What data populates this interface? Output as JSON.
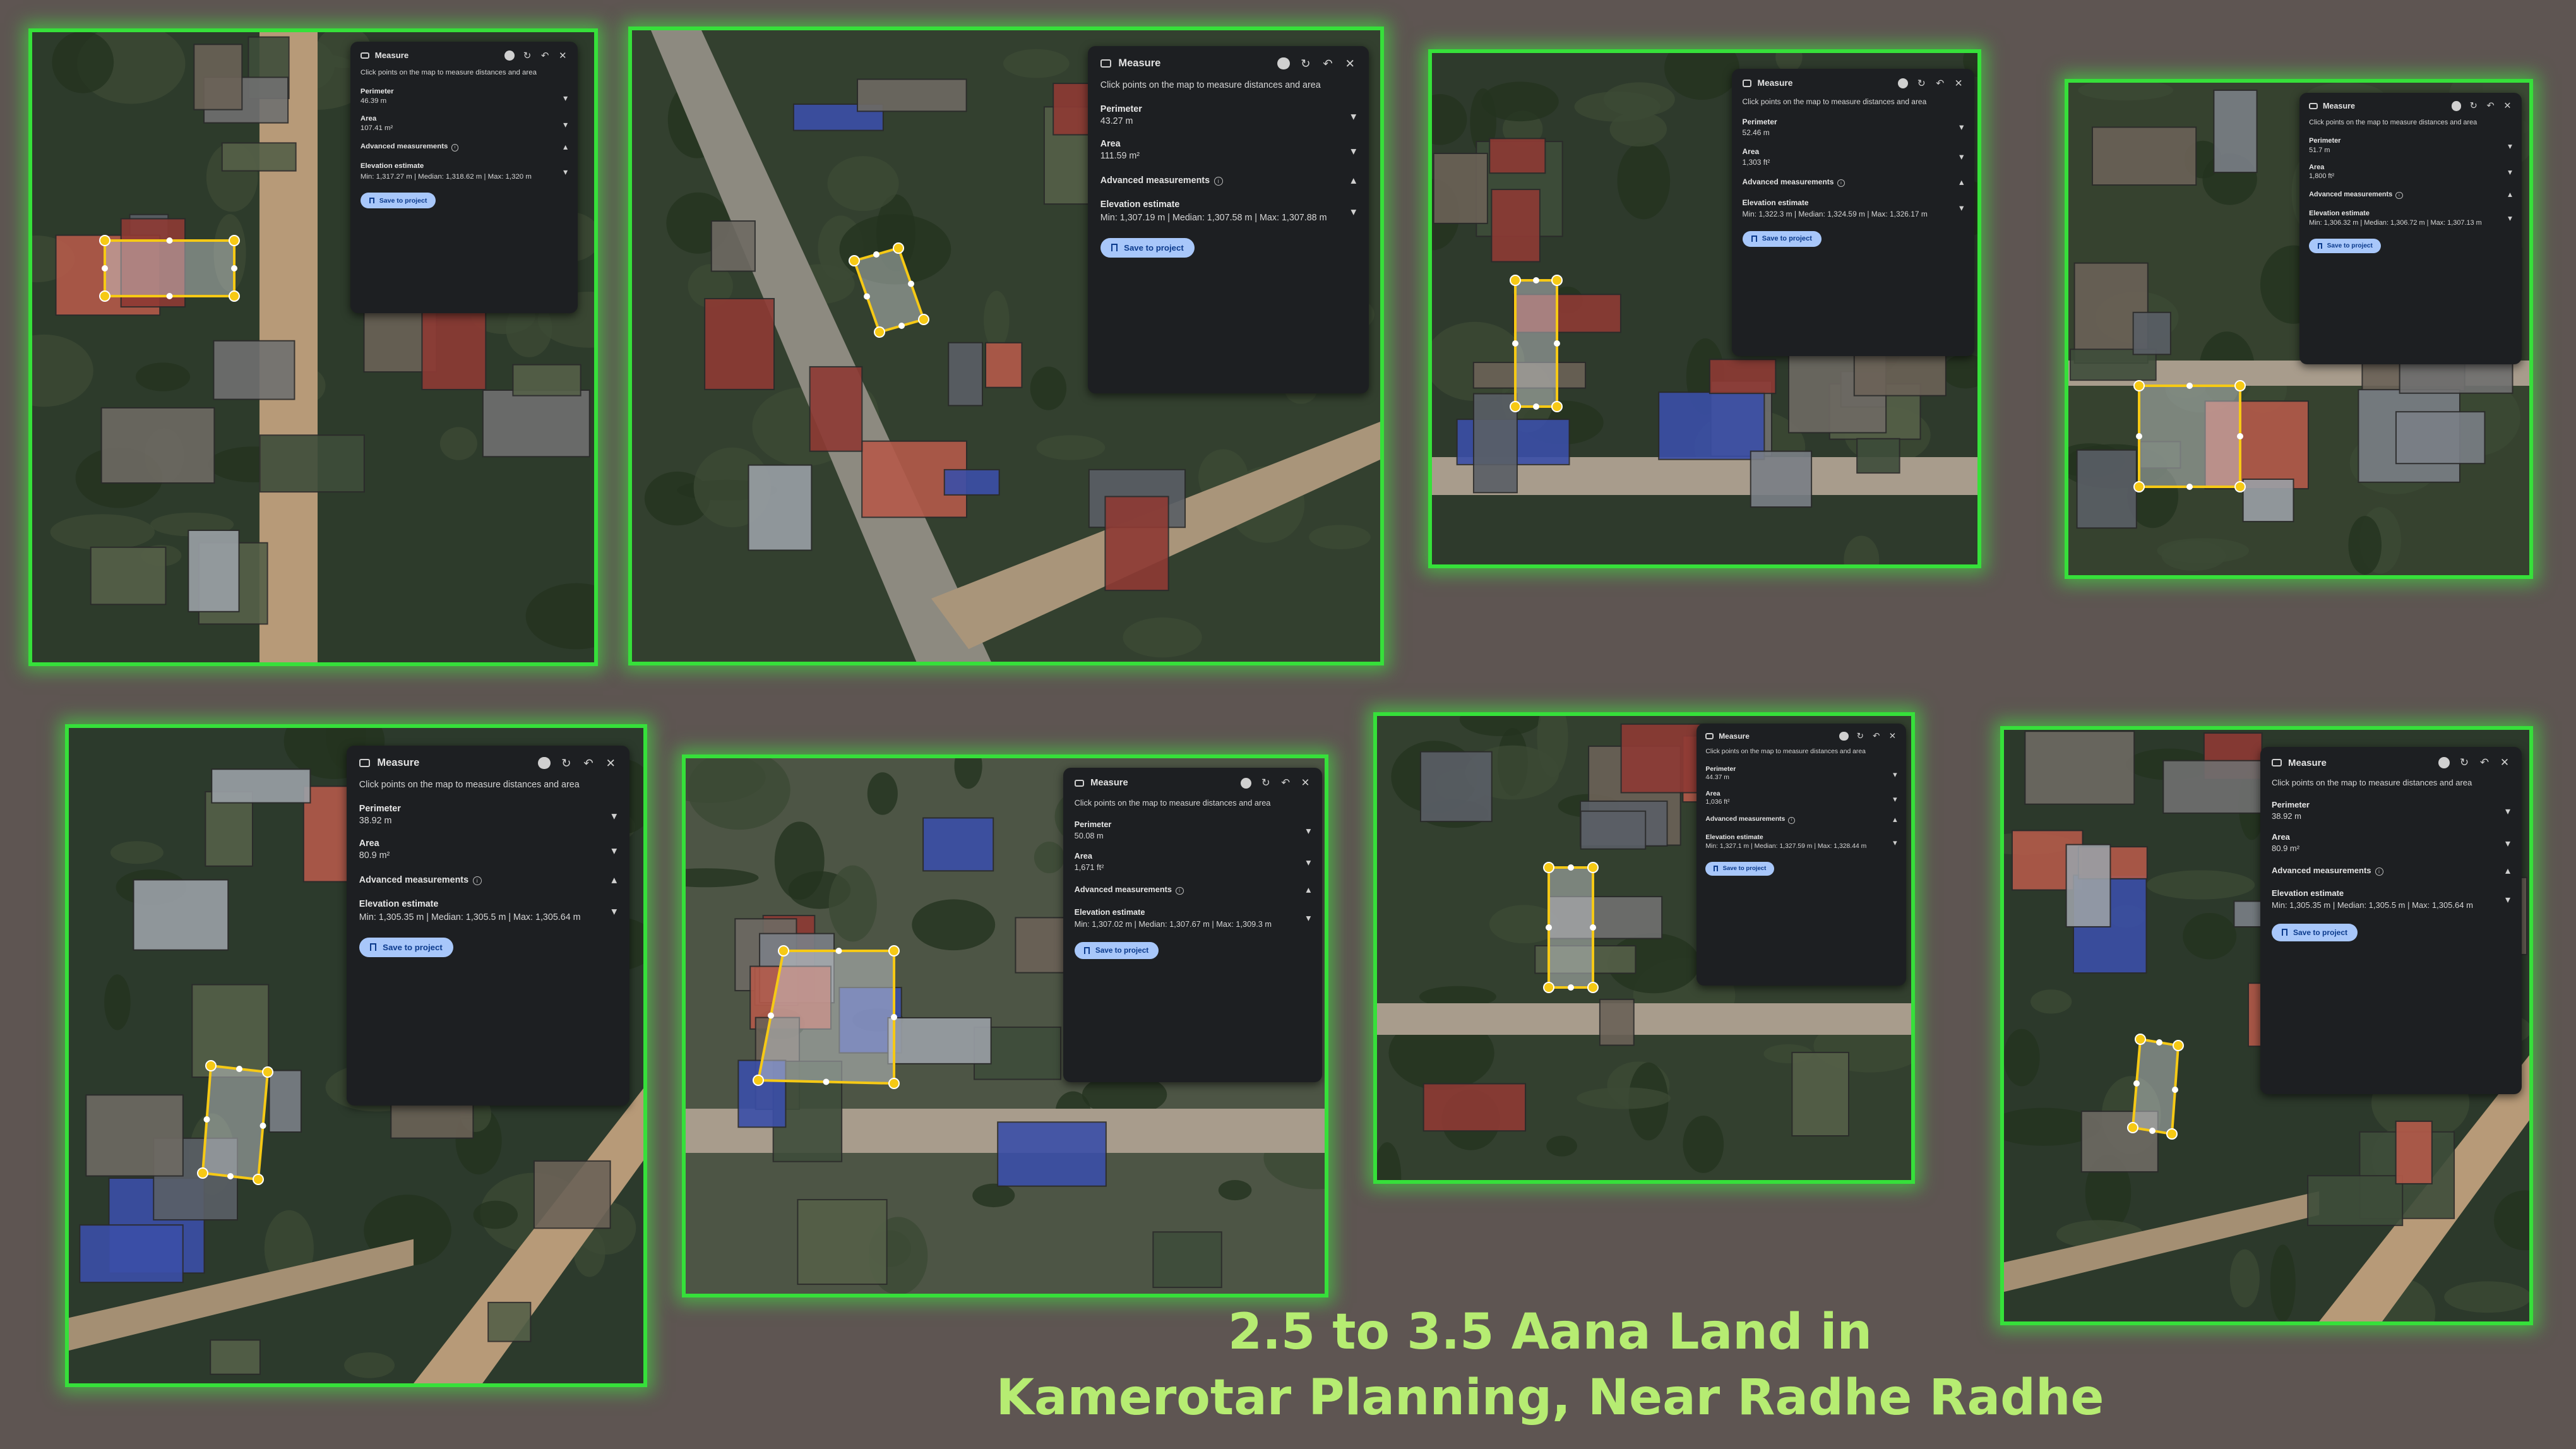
{
  "caption": {
    "line1": "2.5 to 3.5 Aana Land in",
    "line2": "Kamerotar Planning, Near Radhe Radhe"
  },
  "colors": {
    "frame_glow": "#36e03a",
    "background": "#5e5552",
    "caption_text": "#b6ec72",
    "polygon_outline": "#f6c915",
    "panel_bg": "#1d1f22",
    "save_button": "#a8c7fa"
  },
  "panel_common": {
    "title": "Measure",
    "instructions": "Click points on the map to measure distances and area",
    "perimeter_label": "Perimeter",
    "area_label": "Area",
    "advanced_label": "Advanced measurements",
    "elevation_label": "Elevation estimate",
    "save_label": "Save to project",
    "icons": [
      "map-window-icon",
      "help-icon",
      "refresh-icon",
      "undo-icon",
      "close-icon",
      "chevron-down-icon",
      "chevron-up-icon",
      "info-icon",
      "bookmark-icon"
    ]
  },
  "screenshots": [
    {
      "perimeter": "46.39 m",
      "area": "107.41 m²",
      "elevation": "Min: 1,317.27 m | Median: 1,318.62 m | Max: 1,320 m"
    },
    {
      "perimeter": "43.27 m",
      "area": "111.59 m²",
      "elevation": "Min: 1,307.19 m | Median: 1,307.58 m | Max: 1,307.88 m"
    },
    {
      "perimeter": "52.46 m",
      "area": "1,303 ft²",
      "elevation": "Min: 1,322.3 m | Median: 1,324.59 m | Max: 1,326.17 m"
    },
    {
      "perimeter": "51.7 m",
      "area": "1,800 ft²",
      "elevation": "Min: 1,306.32 m | Median: 1,306.72 m | Max: 1,307.13 m"
    },
    {
      "perimeter": "38.92 m",
      "area": "80.9 m²",
      "elevation": "Min: 1,305.35 m | Median: 1,305.5 m | Max: 1,305.64 m"
    },
    {
      "perimeter": "50.08 m",
      "area": "1,671 ft²",
      "elevation": "Min: 1,307.02 m | Median: 1,307.67 m | Max: 1,309.3 m"
    },
    {
      "perimeter": "44.37 m",
      "area": "1,036 ft²",
      "elevation": "Min: 1,327.1 m | Median: 1,327.59 m | Max: 1,328.44 m"
    },
    {
      "perimeter": "38.92 m",
      "area": "80.9 m²",
      "elevation": "Min: 1,305.35 m | Median: 1,305.5 m | Max: 1,305.64 m"
    }
  ]
}
